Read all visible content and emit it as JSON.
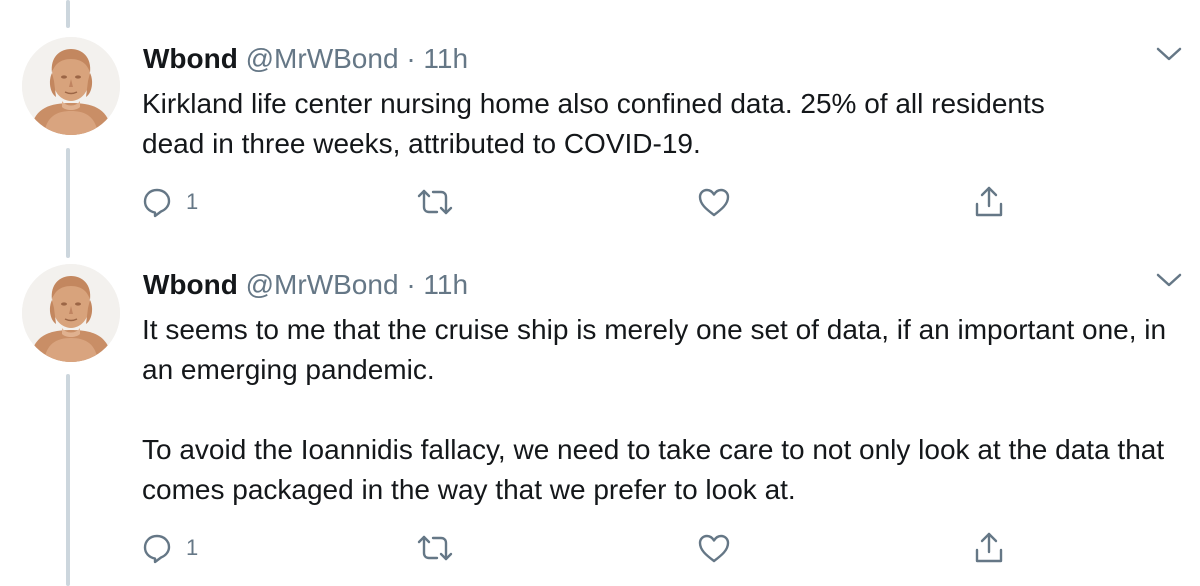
{
  "tweets": [
    {
      "display_name": "Wbond",
      "handle": "@MrWBond",
      "separator": "·",
      "time": "11h",
      "text_lines": [
        "Kirkland life center nursing home also confined data.  25% of all residents",
        "dead in three weeks, attributed to COVID-19."
      ],
      "reply_count": "1",
      "icons": {
        "avatar": "franklin-bust-avatar",
        "more": "chevron-down-icon",
        "reply": "reply-bubble-icon",
        "retweet": "retweet-arrows-icon",
        "like": "heart-icon",
        "share": "share-upload-icon"
      }
    },
    {
      "display_name": "Wbond",
      "handle": "@MrWBond",
      "separator": "·",
      "time": "11h",
      "paragraphs": [
        "It seems to me that the cruise ship is merely one set of data, if an important one, in an emerging pandemic.",
        "To avoid the Ioannidis fallacy, we need to take care to not only look at the data that comes packaged in the way that we prefer to look at."
      ],
      "reply_count": "1",
      "icons": {
        "avatar": "franklin-bust-avatar",
        "more": "chevron-down-icon",
        "reply": "reply-bubble-icon",
        "retweet": "retweet-arrows-icon",
        "like": "heart-icon",
        "share": "share-upload-icon"
      }
    }
  ],
  "colors": {
    "text": "#14171a",
    "secondary": "#657786",
    "thread_line": "#ccd6dd",
    "avatar_skin": "#d6a07a"
  }
}
